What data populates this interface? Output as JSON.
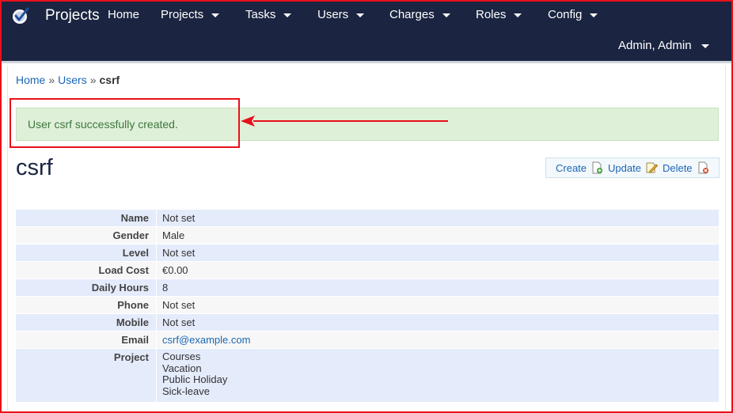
{
  "navbar": {
    "brand": "Projects",
    "items": [
      {
        "label": "Home",
        "dropdown": false
      },
      {
        "label": "Projects",
        "dropdown": true
      },
      {
        "label": "Tasks",
        "dropdown": true
      },
      {
        "label": "Users",
        "dropdown": true
      },
      {
        "label": "Charges",
        "dropdown": true
      },
      {
        "label": "Roles",
        "dropdown": true
      },
      {
        "label": "Config",
        "dropdown": true
      }
    ],
    "user_menu": "Admin, Admin"
  },
  "breadcrumb": {
    "home": "Home",
    "separator": "»",
    "users": "Users",
    "current": "csrf"
  },
  "flash": {
    "message": "User csrf successfully created."
  },
  "page": {
    "title": "csrf"
  },
  "operations": {
    "create": "Create",
    "update": "Update",
    "delete": "Delete"
  },
  "details": {
    "rows": [
      {
        "label": "Name",
        "value": "Not set",
        "null": true
      },
      {
        "label": "Gender",
        "value": "Male"
      },
      {
        "label": "Level",
        "value": "Not set",
        "null": true
      },
      {
        "label": "Load Cost",
        "value": "€0.00"
      },
      {
        "label": "Daily Hours",
        "value": "8"
      },
      {
        "label": "Phone",
        "value": "Not set",
        "null": true
      },
      {
        "label": "Mobile",
        "value": "Not set",
        "null": true
      },
      {
        "label": "Email",
        "value": "csrf@example.com",
        "link": true
      }
    ],
    "project_label": "Project",
    "projects": [
      "Courses",
      "Vacation",
      "Public Holiday",
      "Sick-leave"
    ]
  },
  "colors": {
    "navbar_bg": "#1b2541",
    "link": "#1a66b5",
    "success_bg": "#dff0d8",
    "success_text": "#3c763d",
    "annotation_red": "#e8101a",
    "row_odd": "#e4ebfb",
    "row_even": "#f7f7f7",
    "null_text": "#f3b8c3"
  }
}
